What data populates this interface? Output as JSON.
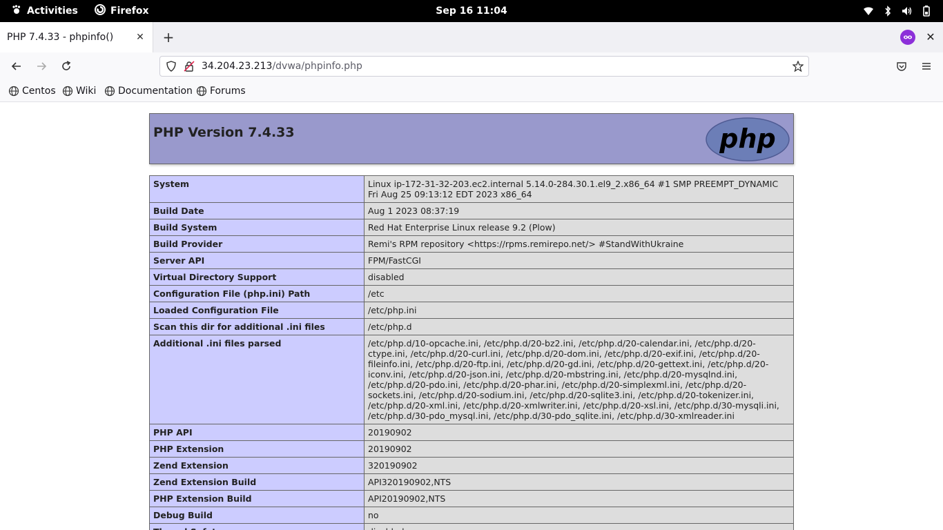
{
  "topbar": {
    "activities": "Activities",
    "app_name": "Firefox",
    "clock": "Sep 16  11:04",
    "tray_icons": [
      "wifi-icon",
      "bluetooth-icon",
      "volume-icon",
      "battery-icon"
    ]
  },
  "browser": {
    "tab_title": "PHP 7.4.33 - phpinfo()",
    "url_host": "34.204.23.213",
    "url_path": "/dvwa/phpinfo.php",
    "bookmarks": [
      "Centos",
      "Wiki",
      "Documentation",
      "Forums"
    ]
  },
  "page": {
    "heading": "PHP Version 7.4.33",
    "logo_text": "php",
    "rows": [
      {
        "key": "System",
        "value": "Linux ip-172-31-32-203.ec2.internal 5.14.0-284.30.1.el9_2.x86_64 #1 SMP PREEMPT_DYNAMIC Fri Aug 25 09:13:12 EDT 2023 x86_64"
      },
      {
        "key": "Build Date",
        "value": "Aug 1 2023 08:37:19"
      },
      {
        "key": "Build System",
        "value": "Red Hat Enterprise Linux release 9.2 (Plow)"
      },
      {
        "key": "Build Provider",
        "value": "Remi's RPM repository <https://rpms.remirepo.net/> #StandWithUkraine"
      },
      {
        "key": "Server API",
        "value": "FPM/FastCGI"
      },
      {
        "key": "Virtual Directory Support",
        "value": "disabled"
      },
      {
        "key": "Configuration File (php.ini) Path",
        "value": "/etc"
      },
      {
        "key": "Loaded Configuration File",
        "value": "/etc/php.ini"
      },
      {
        "key": "Scan this dir for additional .ini files",
        "value": "/etc/php.d"
      },
      {
        "key": "Additional .ini files parsed",
        "value": "/etc/php.d/10-opcache.ini, /etc/php.d/20-bz2.ini, /etc/php.d/20-calendar.ini, /etc/php.d/20-ctype.ini, /etc/php.d/20-curl.ini, /etc/php.d/20-dom.ini, /etc/php.d/20-exif.ini, /etc/php.d/20-fileinfo.ini, /etc/php.d/20-ftp.ini, /etc/php.d/20-gd.ini, /etc/php.d/20-gettext.ini, /etc/php.d/20-iconv.ini, /etc/php.d/20-json.ini, /etc/php.d/20-mbstring.ini, /etc/php.d/20-mysqlnd.ini, /etc/php.d/20-pdo.ini, /etc/php.d/20-phar.ini, /etc/php.d/20-simplexml.ini, /etc/php.d/20-sockets.ini, /etc/php.d/20-sodium.ini, /etc/php.d/20-sqlite3.ini, /etc/php.d/20-tokenizer.ini, /etc/php.d/20-xml.ini, /etc/php.d/20-xmlwriter.ini, /etc/php.d/20-xsl.ini, /etc/php.d/30-mysqli.ini, /etc/php.d/30-pdo_mysql.ini, /etc/php.d/30-pdo_sqlite.ini, /etc/php.d/30-xmlreader.ini"
      },
      {
        "key": "PHP API",
        "value": "20190902"
      },
      {
        "key": "PHP Extension",
        "value": "20190902"
      },
      {
        "key": "Zend Extension",
        "value": "320190902"
      },
      {
        "key": "Zend Extension Build",
        "value": "API320190902,NTS"
      },
      {
        "key": "PHP Extension Build",
        "value": "API20190902,NTS"
      },
      {
        "key": "Debug Build",
        "value": "no"
      },
      {
        "key": "Thread Safety",
        "value": "disabled"
      }
    ]
  }
}
